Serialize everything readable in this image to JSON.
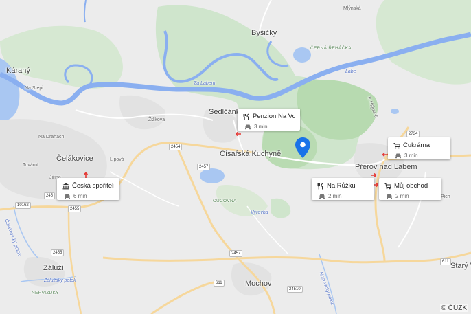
{
  "map": {
    "places": {
      "bysicky": "Byšičky",
      "karany": "Káraný",
      "sedlcanky": "Sedlčánky",
      "celakovice": "Čelákovice",
      "cisarska_kuchyne": "Císařská Kuchyně",
      "prerov": "Přerov nad Labem",
      "zaluzi": "Záluží",
      "mochov": "Mochov",
      "stary": "Starý Ve",
      "zizkova": "Žižkova",
      "lipova": "Lipová",
      "na_stepi": "Na Stepi",
      "na_drahi": "Na Drahách",
      "tovarni": "Tovární",
      "jirina": "Jiřina",
      "cucovna": "CUCOVNA",
      "nehvizdky": "NEHVIZDKY",
      "cerna_rehacka": "ČERNÁ ŘEHÁČKA",
      "mlynska": "Mlýnská",
      "pich": "Pich"
    },
    "rivers": {
      "labe": "Labe",
      "za_labem": "Za Labem",
      "celakovicky_potok": "Čelákovický potok",
      "zaluzsky_potok": "Zálužský potok",
      "vyrovka": "Výrovka",
      "novocesky_potok": "Nosovický potok",
      "k_hajovne": "K Hájovně"
    },
    "roads": {
      "r2454": "2454",
      "r2457a": "2457",
      "r2457b": "2457",
      "r245": "245",
      "r10162": "10162",
      "r2455a": "2455",
      "r2455b": "2455",
      "r611a": "611",
      "r611b": "611",
      "r24510": "24510",
      "r2734": "2734"
    }
  },
  "pois": [
    {
      "id": "penzion",
      "type": "restaurant",
      "name": "Penzion Na Vošv...",
      "time": "3 min"
    },
    {
      "id": "cukrarna",
      "type": "shop",
      "name": "Cukrárna",
      "time": "3 min"
    },
    {
      "id": "ceska",
      "type": "bank",
      "name": "Česká spořitelna",
      "time": "6 min"
    },
    {
      "id": "narozku",
      "type": "restaurant",
      "name": "Na Růžku",
      "time": "2 min"
    },
    {
      "id": "mujobchod",
      "type": "shop",
      "name": "Můj obchod",
      "time": "2 min"
    }
  ],
  "attribution": "© ČÚZK",
  "colors": {
    "water": "#a9c7f2",
    "river": "#8aaff0",
    "forest": "#c8e2c3",
    "field": "#dfeadb",
    "town": "#dedede",
    "major_road": "#f6d79b",
    "road": "#ffffff",
    "pin": "#1a73e8"
  }
}
